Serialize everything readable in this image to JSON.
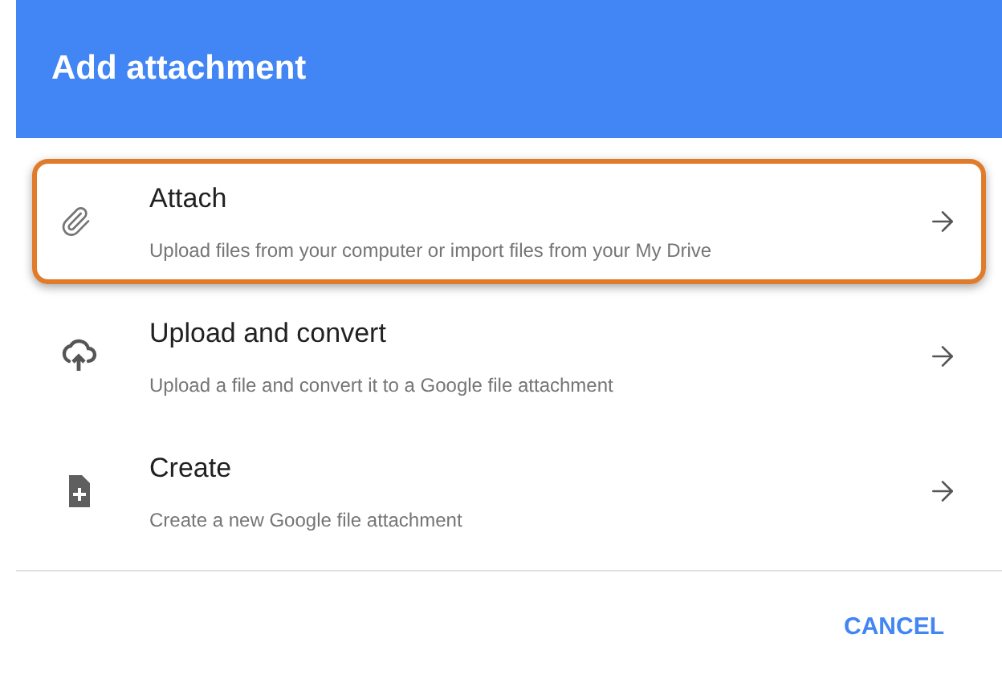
{
  "dialog": {
    "title": "Add attachment"
  },
  "options": [
    {
      "kind": "attach",
      "title": "Attach",
      "description": "Upload files from your computer or import files from your My Drive",
      "selected": true
    },
    {
      "kind": "upload",
      "title": "Upload and convert",
      "description": "Upload a file and convert it to a Google file attachment",
      "selected": false
    },
    {
      "kind": "create",
      "title": "Create",
      "description": "Create a new Google file attachment",
      "selected": false
    }
  ],
  "buttons": [
    "CANCEL"
  ]
}
